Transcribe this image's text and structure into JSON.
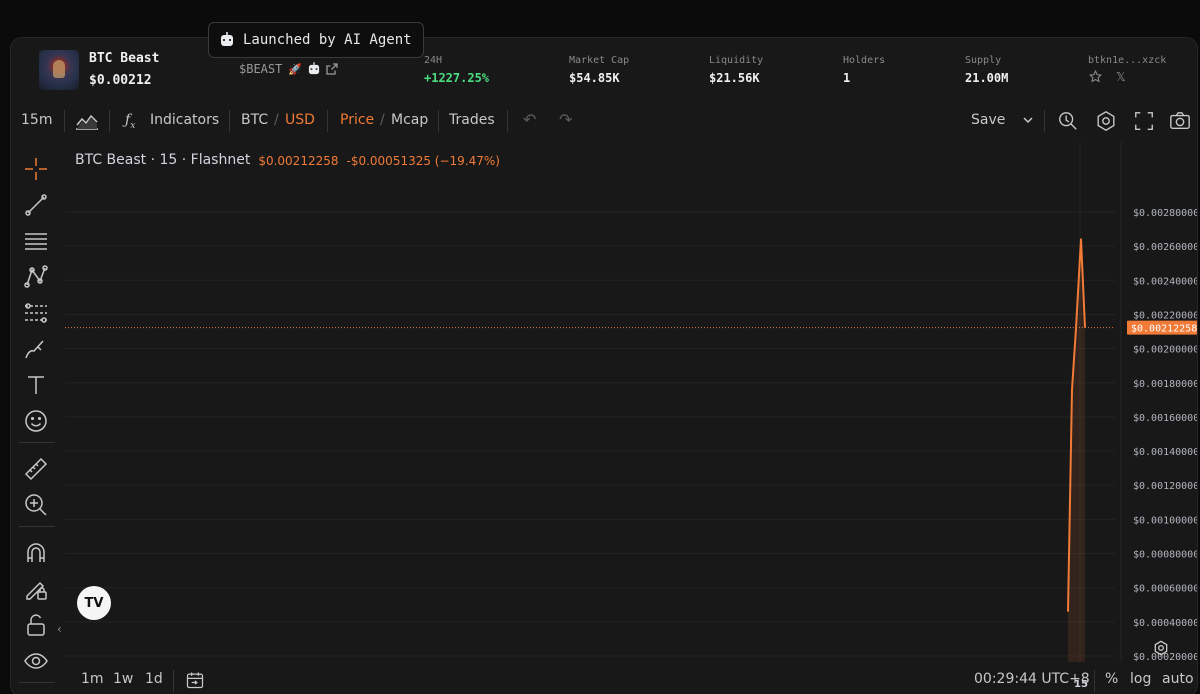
{
  "badge": {
    "text": "Launched by AI Agent"
  },
  "token": {
    "name": "BTC Beast",
    "price": "$0.00212",
    "ticker": "$BEAST"
  },
  "stats": [
    {
      "label": "24H",
      "value": "+1227.25%"
    },
    {
      "label": "Market Cap",
      "value": "$54.85K"
    },
    {
      "label": "Liquidity",
      "value": "$21.56K"
    },
    {
      "label": "Holders",
      "value": "1"
    },
    {
      "label": "Supply",
      "value": "21.00M"
    }
  ],
  "address": {
    "text": "btkn1e...xzck",
    "x_icon": "𝕏"
  },
  "toolbar": {
    "interval": "15m",
    "indicators": "Indicators",
    "pair_base": "BTC",
    "pair_slash": "/",
    "pair_quote": "USD",
    "view_price": "Price",
    "view_slash": "/",
    "view_mcap": "Mcap",
    "trades": "Trades",
    "save": "Save"
  },
  "legend": {
    "title": "BTC Beast · 15 · Flashnet",
    "price": "$0.00212258",
    "change": "-$0.00051325 (−19.47%)"
  },
  "colors": {
    "accent": "#f07a36",
    "up": "#4ade80",
    "bg": "#181818"
  },
  "chart_data": {
    "type": "line",
    "y_ticks": [
      "$0.00280000",
      "$0.00260000",
      "$0.00240000",
      "$0.00220000",
      "$0.00200000",
      "$0.00180000",
      "$0.00160000",
      "$0.00140000",
      "$0.00120000",
      "$0.00100000",
      "$0.00080000",
      "$0.00060000",
      "$0.00040000",
      "$0.00020000"
    ],
    "ylim": [
      0.00016,
      0.0029
    ],
    "x_ticks": [
      "15"
    ],
    "series": [
      {
        "values": [
          0.00046,
          0.00176,
          0.00212,
          0.00264,
          0.00212258
        ]
      }
    ],
    "last_price_label": "$0.00212258",
    "grid": true
  },
  "bottombar": {
    "r1": "1m",
    "r2": "1w",
    "r3": "1d",
    "time": "00:29:44 UTC+8",
    "percent": "%",
    "log": "log",
    "auto": "auto"
  }
}
